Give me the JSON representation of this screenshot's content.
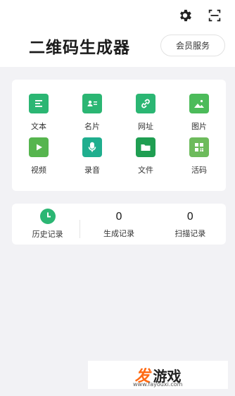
{
  "header": {
    "title": "二维码生成器",
    "member_button": "会员服务",
    "icons": [
      "gear-icon",
      "scan-icon"
    ]
  },
  "tools": [
    {
      "label": "文本",
      "icon": "text-icon",
      "color": "#2bb673"
    },
    {
      "label": "名片",
      "icon": "card-icon",
      "color": "#2bb673"
    },
    {
      "label": "网址",
      "icon": "link-icon",
      "color": "#2bb673"
    },
    {
      "label": "图片",
      "icon": "image-icon",
      "color": "#4cbb5a"
    },
    {
      "label": "视频",
      "icon": "video-icon",
      "color": "#56b54e"
    },
    {
      "label": "录音",
      "icon": "mic-icon",
      "color": "#1fae8e"
    },
    {
      "label": "文件",
      "icon": "folder-icon",
      "color": "#1f9e52"
    },
    {
      "label": "活码",
      "icon": "qr-icon",
      "color": "#6dbb5c"
    }
  ],
  "stats": {
    "history_label": "历史记录",
    "generated_count": "0",
    "generated_label": "生成记录",
    "scanned_count": "0",
    "scanned_label": "扫描记录"
  },
  "watermark": {
    "logo": "发",
    "name": "游戏",
    "url": "www.fayouxi.com"
  }
}
